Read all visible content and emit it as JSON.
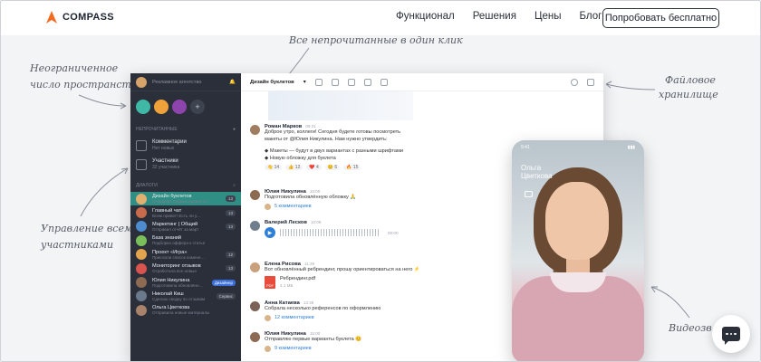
{
  "nav": {
    "logo": "COMPASS",
    "links": [
      "Функционал",
      "Решения",
      "Цены",
      "Блог"
    ],
    "cta": "Попробовать бесплатно",
    "accent": "#f26b21"
  },
  "annotations": {
    "top": "Все непрочитанные в один клик",
    "left_top_1": "Неограниченное",
    "left_top_2": "число пространств",
    "left_bottom_1": "Управление всеми",
    "left_bottom_2": "участниками",
    "right_top_1": "Файловое",
    "right_top_2": "хранилище",
    "right_bottom": "Видеозв"
  },
  "app": {
    "workspace": "Рекламное агентство",
    "unread_label": "НЕПРОЧИТАННЫЕ",
    "comments_title": "Комментарии",
    "comments_sub": "Нет новых",
    "members_title": "Участники",
    "members_sub": "32 участника",
    "dialogs_label": "ДИАЛОГИ",
    "chats": [
      {
        "name": "Дизайн буклетов",
        "preview": "Отправлю первые варианты…",
        "badge": "13",
        "color": "#e0b070"
      },
      {
        "name": "Главный чат",
        "preview": "Всем привет! Есть ли у…",
        "badge": "13",
        "color": "#c76b4a"
      },
      {
        "name": "Маркетинг | Общий",
        "preview": "Отправил отчёт за март",
        "badge": "13",
        "color": "#4d8ccf"
      },
      {
        "name": "База знаний",
        "preview": "Подборка оффера к статье",
        "badge": "",
        "color": "#7bbf5a"
      },
      {
        "name": "Проект «Игра»",
        "preview": "Прислали список измене…",
        "badge": "12",
        "color": "#e2a44c"
      },
      {
        "name": "Мониторинг отзывов",
        "preview": "Отработала все новые",
        "badge": "13",
        "color": "#d9544f"
      },
      {
        "name": "Юлия Никулина",
        "preview": "Подготовила обновлённ…",
        "badge": "Дизайнер",
        "color": "#8d6a52"
      },
      {
        "name": "Николай Киш",
        "preview": "Сделаю сводку по отзывам",
        "badge": "Сервис",
        "color": "#6a7a8c"
      },
      {
        "name": "Ольга Цветкова",
        "preview": "Отправила новые материалы",
        "badge": "",
        "color": "#a8826a"
      }
    ],
    "chat_title": "Дизайн буклетов",
    "messages": [
      {
        "name": "Роман Марков",
        "time": "09:21",
        "lines": [
          "Доброе утро, коллеги! Сегодня будете готовы посмотреть",
          "макеты от @Юлия Никулина. Нам нужно утвердить:",
          "",
          "◆ Макеты — будут в двух вариантах с разными шрифтами",
          "◆ Новую обложку для буклета"
        ],
        "reactions": [
          "👋 14",
          "👍 12",
          "❤️ 4",
          "😊 6",
          "🔥 15"
        ]
      },
      {
        "name": "Юлия Никулина",
        "time": "10:00",
        "lines": [
          "Подготовила обновлённую обложку 🙏"
        ],
        "comments": "5 комментариев"
      },
      {
        "name": "Валерий Лесков",
        "time": "10:08",
        "duration": "00:00"
      },
      {
        "name": "Елена Рисова",
        "time": "11:29",
        "lines": [
          "Вот обновлённый ребрендинг, прошу ориентироваться на него ⚡"
        ],
        "file": "Ребрендинг.pdf",
        "file_size": "4.1 МБ"
      },
      {
        "name": "Анна Катаева",
        "time": "13:45",
        "lines": [
          "Собрала несколько референсов по оформлению"
        ],
        "comments": "12 комментариев"
      },
      {
        "name": "Юлия Никулина",
        "time": "15:00",
        "lines": [
          "Отправляю первые варианты буклета 😊"
        ],
        "comments": "9 комментариев"
      }
    ]
  },
  "phone": {
    "time": "9:41",
    "caller_1": "Ольга",
    "caller_2": "Цветкова"
  }
}
